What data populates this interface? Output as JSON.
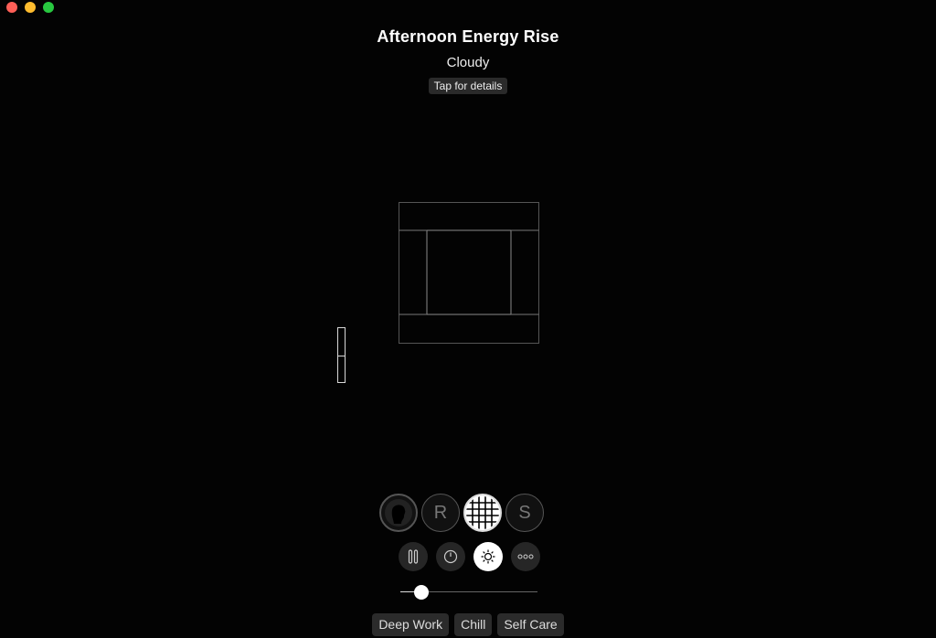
{
  "window": {
    "traffic_lights": [
      "close",
      "minimize",
      "maximize"
    ]
  },
  "header": {
    "title": "Afternoon Energy Rise",
    "subtitle": "Cloudy",
    "details_label": "Tap for details"
  },
  "soundscapes": [
    {
      "name": "focus",
      "icon": "head-silhouette-icon",
      "label": ""
    },
    {
      "name": "relax",
      "icon": "",
      "label": "R"
    },
    {
      "name": "grid",
      "icon": "grid-globe-icon",
      "label": "",
      "active": true
    },
    {
      "name": "sleep",
      "icon": "",
      "label": "S"
    }
  ],
  "controls": [
    {
      "name": "pause",
      "icon": "pause-icon"
    },
    {
      "name": "timer",
      "icon": "timer-icon"
    },
    {
      "name": "brightness",
      "icon": "sun-icon",
      "active": true
    },
    {
      "name": "more",
      "icon": "more-dots-icon"
    }
  ],
  "volume": {
    "level": 0.15
  },
  "presets": [
    "Deep Work",
    "Chill",
    "Self Care"
  ],
  "colors": {
    "background": "#030303",
    "accent": "#ffffff",
    "button_bg": "#2b2b2b"
  }
}
